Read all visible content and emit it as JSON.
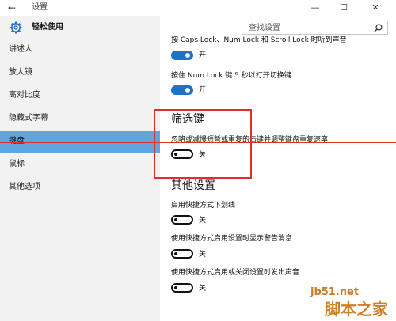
{
  "window": {
    "title": "设置",
    "back_icon": "←",
    "minimize": "—",
    "maximize": "☐",
    "close": "✕"
  },
  "sidebar": {
    "header": "轻松使用",
    "items": [
      {
        "label": "讲述人"
      },
      {
        "label": "放大镜"
      },
      {
        "label": "高对比度"
      },
      {
        "label": "隐藏式字幕"
      },
      {
        "label": "键盘"
      },
      {
        "label": "鼠标"
      },
      {
        "label": "其他选项"
      }
    ],
    "active_index": 4,
    "active_color": "#5ea6de"
  },
  "search": {
    "placeholder": "查找设置"
  },
  "content": {
    "caps_lock_desc": "按 Caps Lock、Num Lock 和 Scroll Lock 时听到声音",
    "caps_lock_toggle": "开",
    "numlock_desc": "按住 Num Lock 键 5 秒以打开切换键",
    "numlock_toggle": "开",
    "filter_heading": "筛选键",
    "filter_desc": "忽略或减慢短暂或重复的击键并调整键盘重复速率",
    "filter_toggle": "关",
    "other_heading": "其他设置",
    "underline_desc": "启用快捷方式下划线",
    "underline_toggle": "关",
    "warn_desc": "使用快捷方式启用设置时显示警告消息",
    "warn_toggle": "关",
    "sound_desc": "使用快捷方式启用或关闭设置时发出声音",
    "sound_toggle": "关"
  },
  "colors": {
    "toggle_on": "#1e72c8",
    "annotation": "#e0302a"
  },
  "watermark": {
    "line1": "jb51.net",
    "line2": "脚本之家"
  }
}
